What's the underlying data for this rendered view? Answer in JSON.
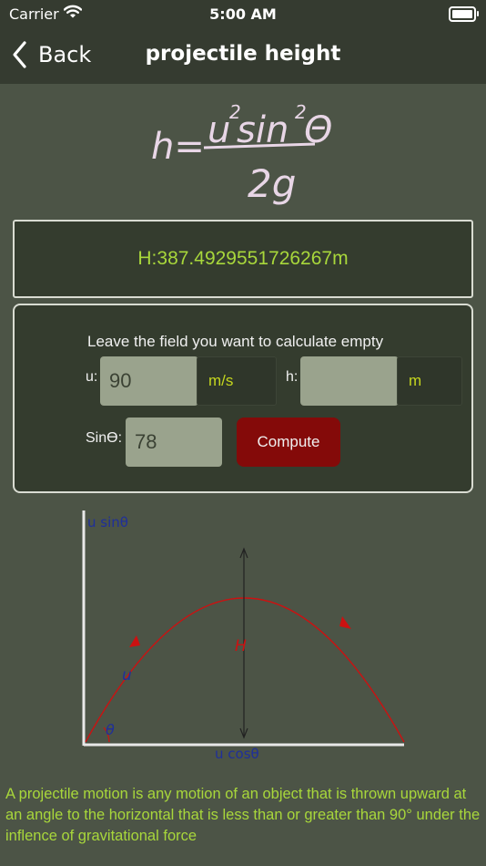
{
  "status_bar": {
    "carrier": "Carrier",
    "time": "5:00 AM"
  },
  "nav": {
    "back_label": "Back",
    "title": "projectile height"
  },
  "formula": {
    "lhs": "h=",
    "numerator_u": "u",
    "numerator_u_exp": "2",
    "numerator_sin": "sin",
    "numerator_sin_exp": "2",
    "numerator_theta": "Θ",
    "denominator": "2g"
  },
  "result": {
    "text": "H:387.4929551726267m"
  },
  "calculator": {
    "instruction": "Leave the field you want to calculate empty",
    "u_label": "u:",
    "u_value": "90",
    "u_unit": "m/s",
    "h_label": "h:",
    "h_value": "",
    "h_unit": "m",
    "sin_label": "Sinϴ:",
    "sin_value": "78",
    "compute_label": "Compute"
  },
  "diagram": {
    "y_axis_label": "u sinθ",
    "x_axis_label": "u cosθ",
    "height_label": "H",
    "velocity_label": "u",
    "angle_label": "θ"
  },
  "description": "A projectile motion is any motion of an object that is thrown upward at an angle to the horizontal that is less than or greater than 90° under the inflence of gravitational force",
  "colors": {
    "background": "#4c5446",
    "bar": "#353b30",
    "accent_green": "#a8d73b",
    "compute_red": "#840a09",
    "curve_red": "#cc1111"
  }
}
